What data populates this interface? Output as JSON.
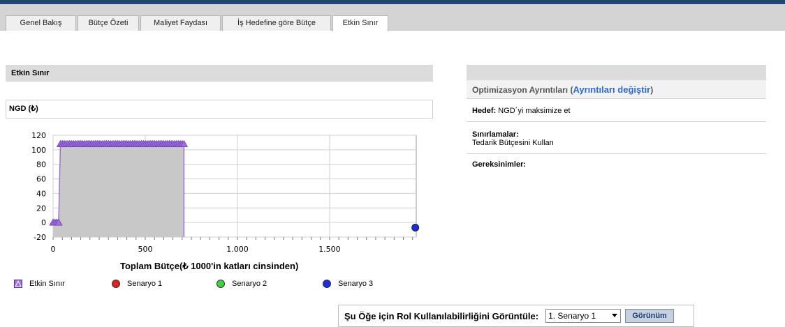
{
  "tabs": [
    {
      "label": "Genel Bakış",
      "active": false
    },
    {
      "label": "Bütçe Özeti",
      "active": false
    },
    {
      "label": "Maliyet Faydası",
      "active": false
    },
    {
      "label": "İş Hedefine göre Bütçe",
      "active": false
    },
    {
      "label": "Etkin Sınır",
      "active": true
    }
  ],
  "left_panel": {
    "title": "Etkin Sınır",
    "chart_header": "NGD (₺)"
  },
  "chart_data": {
    "type": "scatter",
    "title": "NGD (₺)",
    "xlabel": "Toplam Bütçe(₺ 1000'in katları cinsinden)",
    "ylabel": "",
    "xlim": [
      0,
      1970
    ],
    "ylim": [
      -20,
      120
    ],
    "x_ticks": [
      "0",
      "500",
      "1.000",
      "1.500"
    ],
    "x_tick_values": [
      0,
      500,
      1000,
      1500
    ],
    "y_ticks": [
      "120",
      "100",
      "80",
      "60",
      "40",
      "20",
      "0",
      "-20"
    ],
    "y_tick_values": [
      120,
      100,
      80,
      60,
      40,
      20,
      0,
      -20
    ],
    "grid": true,
    "shaded_area": true,
    "series": [
      {
        "name": "Etkin Sınır",
        "marker": "triangle",
        "color": "#a070e0",
        "x": [
          0,
          10,
          20,
          30,
          40,
          50,
          60,
          70,
          80,
          90,
          100,
          110,
          120,
          130,
          140,
          150,
          160,
          170,
          180,
          190,
          200,
          210,
          220,
          230,
          240,
          250,
          260,
          270,
          280,
          290,
          300,
          310,
          320,
          330,
          340,
          350,
          360,
          370,
          380,
          390,
          400,
          410,
          420,
          430,
          440,
          450,
          460,
          470,
          480,
          490,
          500,
          510,
          520,
          530,
          540,
          550,
          560,
          570,
          580,
          590,
          600,
          610,
          620,
          630,
          640,
          650,
          660,
          670,
          680,
          690,
          700,
          710
        ],
        "y": [
          0,
          0,
          0,
          0,
          108,
          108,
          108,
          108,
          108,
          108,
          108,
          108,
          108,
          108,
          108,
          108,
          108,
          108,
          108,
          108,
          108,
          108,
          108,
          108,
          108,
          108,
          108,
          108,
          108,
          108,
          108,
          108,
          108,
          108,
          108,
          108,
          108,
          108,
          108,
          108,
          108,
          108,
          108,
          108,
          108,
          108,
          108,
          108,
          108,
          108,
          108,
          108,
          108,
          108,
          108,
          108,
          108,
          108,
          108,
          108,
          108,
          108,
          108,
          108,
          108,
          108,
          108,
          108,
          108,
          108,
          108,
          108
        ]
      },
      {
        "name": "Senaryo 1",
        "marker": "circle",
        "color": "#e02020",
        "x": [],
        "y": []
      },
      {
        "name": "Senaryo 2",
        "marker": "circle",
        "color": "#40d040",
        "x": [],
        "y": []
      },
      {
        "name": "Senaryo 3",
        "marker": "circle",
        "color": "#1a2ee0",
        "x": [
          1965
        ],
        "y": [
          -7
        ]
      }
    ]
  },
  "legend": [
    {
      "label": "Etkin Sınır",
      "color": "#a070e0",
      "marker": "triangle"
    },
    {
      "label": "Senaryo 1",
      "color": "#e02020",
      "marker": "circle"
    },
    {
      "label": "Senaryo 2",
      "color": "#40d040",
      "marker": "circle"
    },
    {
      "label": "Senaryo 3",
      "color": "#1a2ee0",
      "marker": "circle"
    }
  ],
  "right_panel": {
    "details_label": "Optimizasyon Ayrıntıları (",
    "details_link": "Ayrıntıları değiştir",
    "details_close": ")",
    "goal_label": "Hedef:",
    "goal_value": "NGD´yi maksimize et",
    "constraints_label": "Sınırlamalar:",
    "constraints_value": "Tedarik Bütçesini Kullan",
    "requirements_label": "Gereksinimler:"
  },
  "view_bar": {
    "label": "Şu Öğe için Rol Kullanılabilirliğini Görüntüle:",
    "selected": "1. Senaryo 1",
    "button": "Görünüm"
  },
  "colors": {
    "header_bar": "#22466e",
    "tab_bg": "#d4d4d4",
    "link": "#2a6ad2",
    "area_fill": "#c8c8c8"
  }
}
